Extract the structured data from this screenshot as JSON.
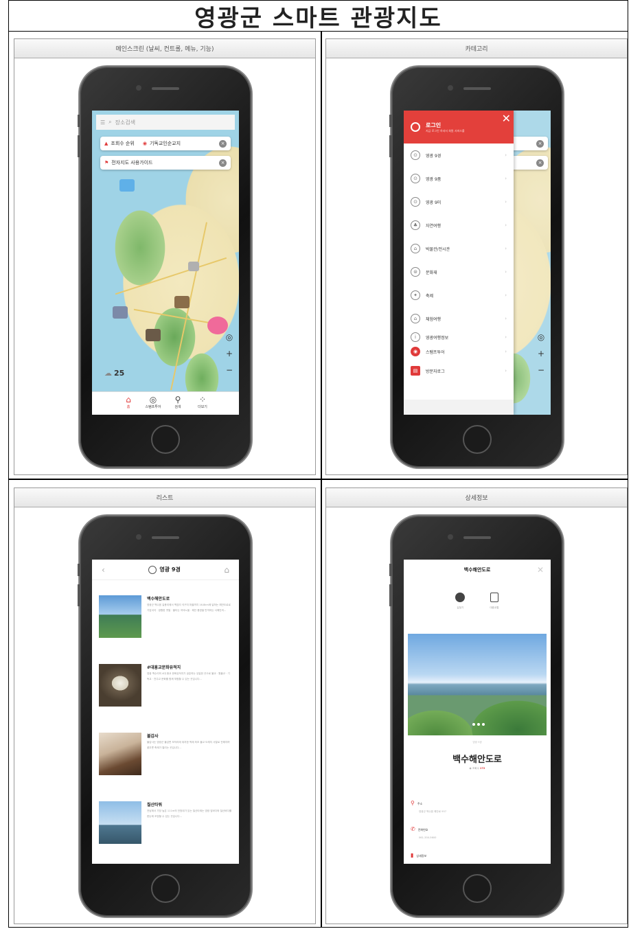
{
  "page_title": "영광군 스마트 관광지도",
  "panels": {
    "main": {
      "header": "메인스크린 (날씨, 컨트롤, 메뉴, 기능)"
    },
    "category": {
      "header": "카테고리"
    },
    "list": {
      "header": "리스트"
    },
    "detail": {
      "header": "상세정보"
    }
  },
  "main_screen": {
    "search_placeholder": "장소검색",
    "chips": [
      {
        "icon": "thumbs-up-icon",
        "label": "조회수 순위"
      },
      {
        "icon": "pin-icon",
        "label": "전자지도 사용가이드"
      }
    ],
    "chip_extra": "기독교인순교지",
    "weather": "25",
    "nav": [
      {
        "icon": "home-icon",
        "label": "홈"
      },
      {
        "icon": "stamp-icon",
        "label": "스탬프투어"
      },
      {
        "icon": "location-icon",
        "label": "검색"
      },
      {
        "icon": "grid-icon",
        "label": "더보기"
      }
    ],
    "controls": [
      "+",
      "−"
    ]
  },
  "category_screen": {
    "login_title": "로그인",
    "login_sub": "지금 로그인 하셔서 회원 서비스를 ",
    "items": [
      "영광 9경",
      "영광 9품",
      "영광 9미",
      "자연여행",
      "박물관/전시관",
      "문화재",
      "축제",
      "체험여행",
      "영광여행정보",
      "스탬프투어",
      "방문자로그"
    ]
  },
  "list_screen": {
    "title": "영광 9경",
    "items": [
      {
        "name": "백수해안도로",
        "desc": "영광군 백수읍 길용리에서 백암리 석구미 마을까지 16.8km에 달하는 해안도로로 기암괴석 · 광활한 갯벌 · 불타는 저녁노을 · 해안 풍경을 만끽하는 서해안의..."
      },
      {
        "name": "#대흥교문화유적지",
        "desc": "영광 백수리의 4대 종교 문화유적지가 공존하는 유일한 곳으로 불교 · 원불교 · 기독교 · 천주교 문화를 함께 체험할 수 있는 곳입니다..."
      },
      {
        "name": "불갑사",
        "desc": "불갑사는 영광군 불갑면 모악리에 위치한 백제 최초 불교 도래지 사찰로 전해지며 꽃무릇 축제가 열리는 곳입니다..."
      },
      {
        "name": "칠산타워",
        "desc": "전남에서 가장 높은 111m의 전망대가 있는 칠산타워는 영광 앞바다와 칠산바다를 한눈에 조망할 수 있는 곳입니다..."
      }
    ]
  },
  "detail_screen": {
    "header": "백수해안도로",
    "icons": [
      {
        "icon": "compass-icon",
        "label": "길찾기"
      },
      {
        "icon": "bus-icon",
        "label": "대중교통"
      }
    ],
    "sub": "영광 9경",
    "title": "백수해안도로",
    "views_label": "조회수",
    "views_value": "172",
    "rows": [
      {
        "label": "주소",
        "value": "영광군 백수읍 해안로 957"
      },
      {
        "label": "전화번호",
        "value": "061-350-5600"
      },
      {
        "label": "상세정보",
        "value": ""
      }
    ]
  }
}
